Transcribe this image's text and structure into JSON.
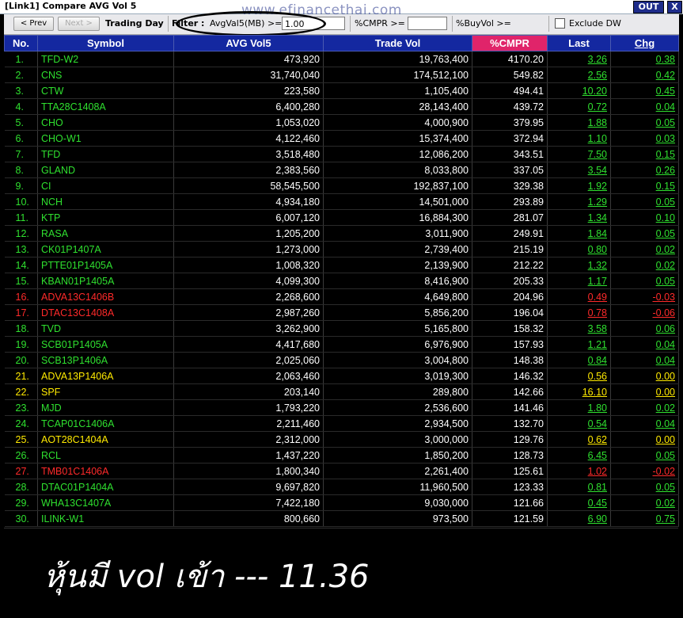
{
  "window": {
    "title": "[Link1] Compare AVG Vol 5",
    "out_label": "OUT",
    "close_label": "X"
  },
  "toolbar": {
    "prev_label": "< Prev",
    "next_label": "Next >",
    "trading_day_label": "Trading Day",
    "filter_label": "Filter :",
    "avgvol_label": "AvgVal5(MB) >=",
    "avgvol_value": "1.00",
    "cmpr_label": "%CMPR >=",
    "cmpr_value": "",
    "buyvol_label": "%BuyVol >=",
    "exclude_label": "Exclude DW",
    "exclude_checked": false
  },
  "watermark": "www.efinancethai.com",
  "columns": [
    "No.",
    "Symbol",
    "AVG Vol5",
    "Trade Vol",
    "%CMPR",
    "Last",
    "Chg"
  ],
  "colors": {
    "up": "#2fe02f",
    "down": "#ff2a2a",
    "unchanged": "#ffea00",
    "header": "#1428a0",
    "cmpr_header": "#e0246a"
  },
  "rows": [
    {
      "no": "1.",
      "symbol": "TFD-W2",
      "avg": "473,920",
      "trade": "19,763,400",
      "cmpr": "4170.20",
      "last": "3.26",
      "chg": "0.38",
      "dir": "g"
    },
    {
      "no": "2.",
      "symbol": "CNS",
      "avg": "31,740,040",
      "trade": "174,512,100",
      "cmpr": "549.82",
      "last": "2.56",
      "chg": "0.42",
      "dir": "g"
    },
    {
      "no": "3.",
      "symbol": "CTW",
      "avg": "223,580",
      "trade": "1,105,400",
      "cmpr": "494.41",
      "last": "10.20",
      "chg": "0.45",
      "dir": "g"
    },
    {
      "no": "4.",
      "symbol": "TTA28C1408A",
      "avg": "6,400,280",
      "trade": "28,143,400",
      "cmpr": "439.72",
      "last": "0.72",
      "chg": "0.04",
      "dir": "g"
    },
    {
      "no": "5.",
      "symbol": "CHO",
      "avg": "1,053,020",
      "trade": "4,000,900",
      "cmpr": "379.95",
      "last": "1.88",
      "chg": "0.05",
      "dir": "g"
    },
    {
      "no": "6.",
      "symbol": "CHO-W1",
      "avg": "4,122,460",
      "trade": "15,374,400",
      "cmpr": "372.94",
      "last": "1.10",
      "chg": "0.03",
      "dir": "g"
    },
    {
      "no": "7.",
      "symbol": "TFD",
      "avg": "3,518,480",
      "trade": "12,086,200",
      "cmpr": "343.51",
      "last": "7.50",
      "chg": "0.15",
      "dir": "g"
    },
    {
      "no": "8.",
      "symbol": "GLAND",
      "avg": "2,383,560",
      "trade": "8,033,800",
      "cmpr": "337.05",
      "last": "3.54",
      "chg": "0.26",
      "dir": "g"
    },
    {
      "no": "9.",
      "symbol": "CI",
      "avg": "58,545,500",
      "trade": "192,837,100",
      "cmpr": "329.38",
      "last": "1.92",
      "chg": "0.15",
      "dir": "g"
    },
    {
      "no": "10.",
      "symbol": "NCH",
      "avg": "4,934,180",
      "trade": "14,501,000",
      "cmpr": "293.89",
      "last": "1.29",
      "chg": "0.05",
      "dir": "g"
    },
    {
      "no": "11.",
      "symbol": "KTP",
      "avg": "6,007,120",
      "trade": "16,884,300",
      "cmpr": "281.07",
      "last": "1.34",
      "chg": "0.10",
      "dir": "g"
    },
    {
      "no": "12.",
      "symbol": "RASA",
      "avg": "1,205,200",
      "trade": "3,011,900",
      "cmpr": "249.91",
      "last": "1.84",
      "chg": "0.05",
      "dir": "g"
    },
    {
      "no": "13.",
      "symbol": "CK01P1407A",
      "avg": "1,273,000",
      "trade": "2,739,400",
      "cmpr": "215.19",
      "last": "0.80",
      "chg": "0.02",
      "dir": "g"
    },
    {
      "no": "14.",
      "symbol": "PTTE01P1405A",
      "avg": "1,008,320",
      "trade": "2,139,900",
      "cmpr": "212.22",
      "last": "1.32",
      "chg": "0.02",
      "dir": "g"
    },
    {
      "no": "15.",
      "symbol": "KBAN01P1405A",
      "avg": "4,099,300",
      "trade": "8,416,900",
      "cmpr": "205.33",
      "last": "1.17",
      "chg": "0.05",
      "dir": "g"
    },
    {
      "no": "16.",
      "symbol": "ADVA13C1406B",
      "avg": "2,268,600",
      "trade": "4,649,800",
      "cmpr": "204.96",
      "last": "0.49",
      "chg": "-0.03",
      "dir": "r"
    },
    {
      "no": "17.",
      "symbol": "DTAC13C1408A",
      "avg": "2,987,260",
      "trade": "5,856,200",
      "cmpr": "196.04",
      "last": "0.78",
      "chg": "-0.06",
      "dir": "r"
    },
    {
      "no": "18.",
      "symbol": "TVD",
      "avg": "3,262,900",
      "trade": "5,165,800",
      "cmpr": "158.32",
      "last": "3.58",
      "chg": "0.06",
      "dir": "g"
    },
    {
      "no": "19.",
      "symbol": "SCB01P1405A",
      "avg": "4,417,680",
      "trade": "6,976,900",
      "cmpr": "157.93",
      "last": "1.21",
      "chg": "0.04",
      "dir": "g"
    },
    {
      "no": "20.",
      "symbol": "SCB13P1406A",
      "avg": "2,025,060",
      "trade": "3,004,800",
      "cmpr": "148.38",
      "last": "0.84",
      "chg": "0.04",
      "dir": "g"
    },
    {
      "no": "21.",
      "symbol": "ADVA13P1406A",
      "avg": "2,063,460",
      "trade": "3,019,300",
      "cmpr": "146.32",
      "last": "0.56",
      "chg": "0.00",
      "dir": "y"
    },
    {
      "no": "22.",
      "symbol": "SPF",
      "avg": "203,140",
      "trade": "289,800",
      "cmpr": "142.66",
      "last": "16.10",
      "chg": "0.00",
      "dir": "y"
    },
    {
      "no": "23.",
      "symbol": "MJD",
      "avg": "1,793,220",
      "trade": "2,536,600",
      "cmpr": "141.46",
      "last": "1.80",
      "chg": "0.02",
      "dir": "g"
    },
    {
      "no": "24.",
      "symbol": "TCAP01C1406A",
      "avg": "2,211,460",
      "trade": "2,934,500",
      "cmpr": "132.70",
      "last": "0.54",
      "chg": "0.04",
      "dir": "g"
    },
    {
      "no": "25.",
      "symbol": "AOT28C1404A",
      "avg": "2,312,000",
      "trade": "3,000,000",
      "cmpr": "129.76",
      "last": "0.62",
      "chg": "0.00",
      "dir": "y"
    },
    {
      "no": "26.",
      "symbol": "RCL",
      "avg": "1,437,220",
      "trade": "1,850,200",
      "cmpr": "128.73",
      "last": "6.45",
      "chg": "0.05",
      "dir": "g"
    },
    {
      "no": "27.",
      "symbol": "TMB01C1406A",
      "avg": "1,800,340",
      "trade": "2,261,400",
      "cmpr": "125.61",
      "last": "1.02",
      "chg": "-0.02",
      "dir": "r"
    },
    {
      "no": "28.",
      "symbol": "DTAC01P1404A",
      "avg": "9,697,820",
      "trade": "11,960,500",
      "cmpr": "123.33",
      "last": "0.81",
      "chg": "0.05",
      "dir": "g"
    },
    {
      "no": "29.",
      "symbol": "WHA13C1407A",
      "avg": "7,422,180",
      "trade": "9,030,000",
      "cmpr": "121.66",
      "last": "0.45",
      "chg": "0.02",
      "dir": "g"
    },
    {
      "no": "30.",
      "symbol": "ILINK-W1",
      "avg": "800,660",
      "trade": "973,500",
      "cmpr": "121.59",
      "last": "6.90",
      "chg": "0.75",
      "dir": "g"
    }
  ],
  "caption": "หุ้นมี vol เข้า --- 11.36"
}
